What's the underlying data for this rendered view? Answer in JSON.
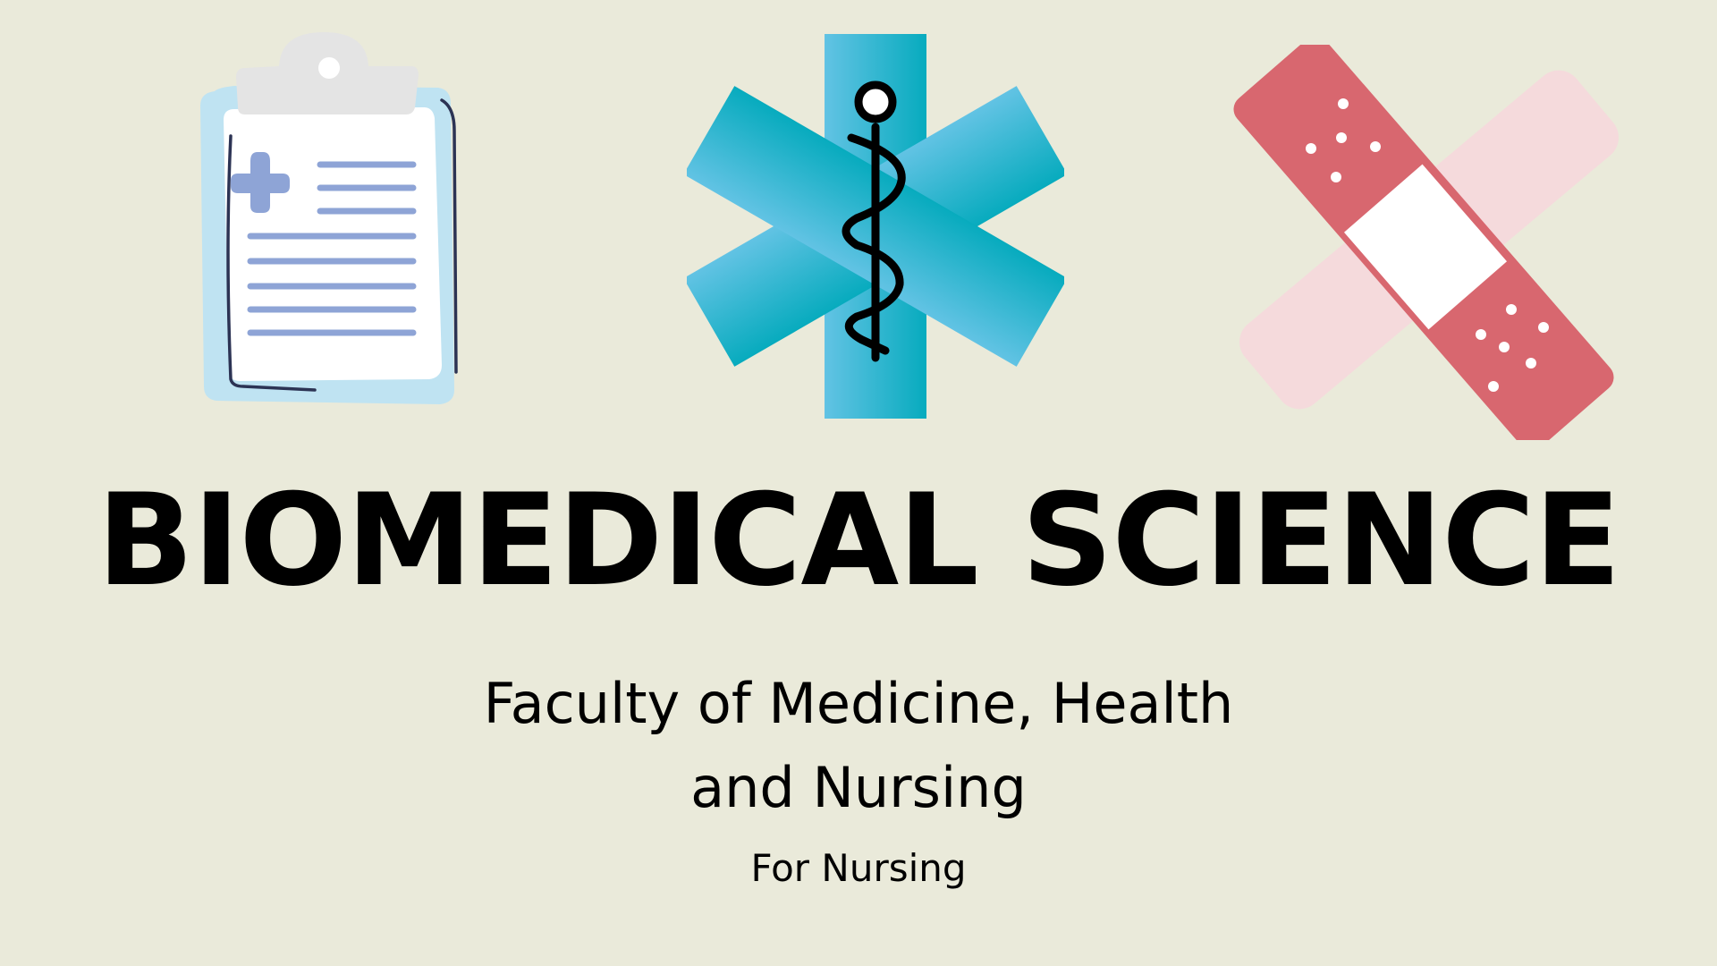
{
  "slide": {
    "title": "BIOMEDICAL SCIENCE",
    "subtitle_line1": "Faculty of Medicine, Health",
    "subtitle_line2": "and Nursing",
    "tagline": "For Nursing"
  },
  "icons": [
    "clipboard-icon",
    "star-of-life-icon",
    "bandage-icon"
  ],
  "colors": {
    "background": "#EAEADA",
    "text": "#000000",
    "clipboard_board": "#BFE3F2",
    "clipboard_paper": "#FFFFFF",
    "clipboard_clip": "#E4E4E4",
    "clipboard_lines": "#8EA4D6",
    "star_gradient_start": "#62C3E4",
    "star_gradient_end": "#07ABBE",
    "bandage_front": "#D8676F",
    "bandage_back": "#F5DADC",
    "bandage_pad": "#FFFFFF"
  }
}
